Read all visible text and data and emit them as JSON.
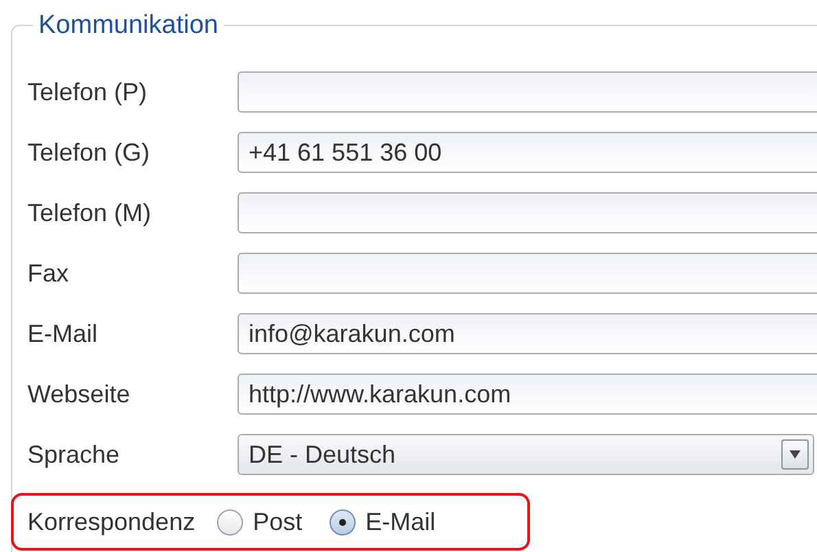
{
  "group": {
    "title": "Kommunikation"
  },
  "fields": [
    {
      "kind": "text",
      "label": "Telefon (P)"
    },
    {
      "kind": "text",
      "label": "Telefon (G)",
      "value": "+41 61 551 36 00"
    },
    {
      "kind": "text",
      "label": "Telefon (M)"
    },
    {
      "kind": "text",
      "label": "Fax"
    },
    {
      "kind": "text",
      "label": "E-Mail",
      "value": "info@karakun.com"
    },
    {
      "kind": "text",
      "label": "Webseite",
      "value": "http://www.karakun.com"
    },
    {
      "kind": "select",
      "label": "Sprache",
      "value": "DE - Deutsch"
    }
  ],
  "correspondence": {
    "label": "Korrespondenz",
    "options": [
      {
        "label": "Post",
        "selected": false
      },
      {
        "label": "E-Mail",
        "selected": true
      }
    ]
  }
}
